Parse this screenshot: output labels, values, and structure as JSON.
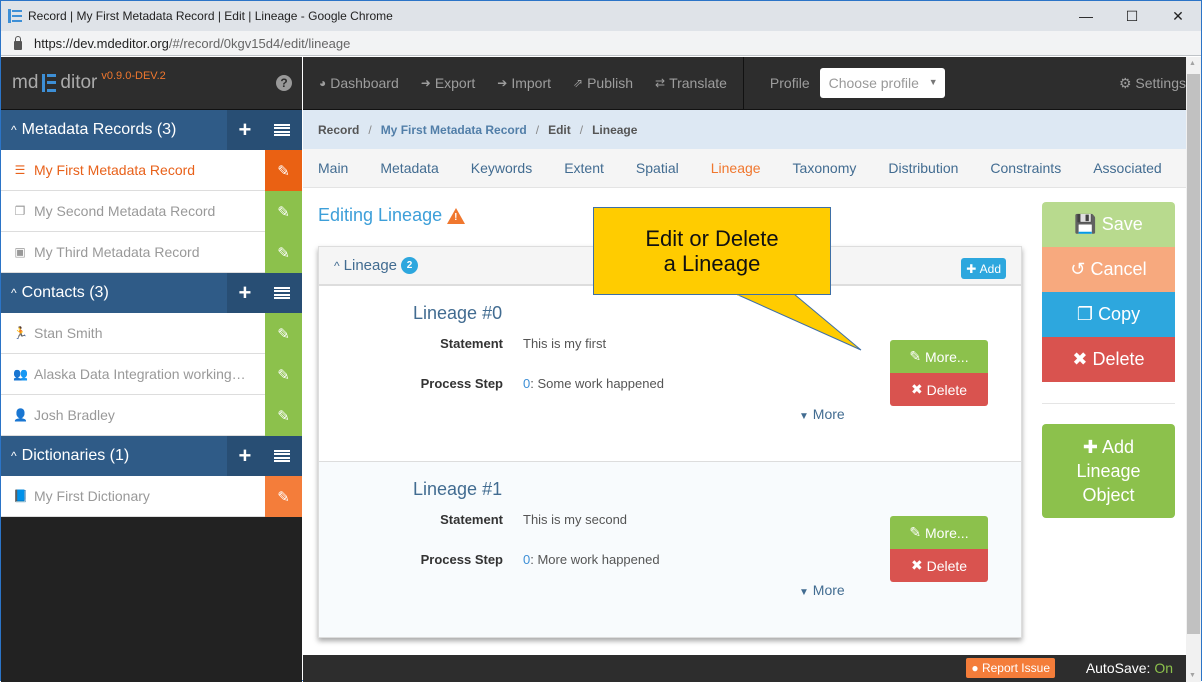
{
  "browser": {
    "title": "Record | My First Metadata Record | Edit | Lineage - Google Chrome",
    "url_host": "https://dev.mdeditor.org",
    "url_path": "/#/record/0kgv15d4/edit/lineage",
    "controls": {
      "minimize": "—",
      "maximize": "☐",
      "close": "✕"
    }
  },
  "brand": {
    "left": "md",
    "right": "ditor",
    "version": "v0.9.0-DEV.2",
    "help": "?"
  },
  "sidebar": {
    "sections": [
      {
        "label": "Metadata Records (3)",
        "items": [
          {
            "label": "My First Metadata Record",
            "icon": "database-icon",
            "glyph": "☰",
            "active": true
          },
          {
            "label": "My Second Metadata Record",
            "icon": "copy-icon",
            "glyph": "❐"
          },
          {
            "label": "My Third Metadata Record",
            "icon": "image-icon",
            "glyph": "▣"
          }
        ]
      },
      {
        "label": "Contacts (3)",
        "items": [
          {
            "label": "Stan Smith",
            "icon": "runner-icon",
            "glyph": "🏃"
          },
          {
            "label": "Alaska Data Integration working…",
            "icon": "group-icon",
            "glyph": "👥"
          },
          {
            "label": "Josh Bradley",
            "icon": "user-icon",
            "glyph": "👤"
          }
        ]
      },
      {
        "label": "Dictionaries (1)",
        "items": [
          {
            "label": "My First Dictionary",
            "icon": "book-icon",
            "glyph": "📘"
          }
        ]
      }
    ]
  },
  "topnav": {
    "items": [
      {
        "label": "Dashboard",
        "glyph": "◕"
      },
      {
        "label": "Export",
        "glyph": "➜"
      },
      {
        "label": "Import",
        "glyph": "➔"
      },
      {
        "label": "Publish",
        "glyph": "⇗"
      },
      {
        "label": "Translate",
        "glyph": "⇄"
      }
    ],
    "profile_label": "Profile",
    "profile_placeholder": "Choose profile",
    "settings": "Settings"
  },
  "breadcrumb": [
    "Record",
    "My First Metadata Record",
    "Edit",
    "Lineage"
  ],
  "tabs": [
    "Main",
    "Metadata",
    "Keywords",
    "Extent",
    "Spatial",
    "Lineage",
    "Taxonomy",
    "Distribution",
    "Constraints",
    "Associated"
  ],
  "active_tab": "Lineage",
  "page_title": "Editing Lineage",
  "panel": {
    "title": "Lineage",
    "count": "2",
    "add_label": "Add",
    "lineages": [
      {
        "title": "Lineage #0",
        "statement_label": "Statement",
        "statement": "This is my first",
        "step_label": "Process Step",
        "step_num": "0",
        "step_text": ": Some work happened",
        "more_link": "More",
        "more_btn": "More...",
        "delete_btn": "Delete"
      },
      {
        "title": "Lineage #1",
        "statement_label": "Statement",
        "statement": "This is my second",
        "step_label": "Process Step",
        "step_num": "0",
        "step_text": ": More work happened",
        "more_link": "More",
        "more_btn": "More...",
        "delete_btn": "Delete"
      }
    ]
  },
  "actions": {
    "save": "Save",
    "cancel": "Cancel",
    "copy": "Copy",
    "delete": "Delete",
    "add_object": [
      "Add",
      "Lineage",
      "Object"
    ]
  },
  "footer": {
    "report": "Report Issue",
    "autosave_label": "AutoSave:",
    "autosave_value": "On"
  },
  "callout": {
    "line1": "Edit or Delete",
    "line2": "a Lineage"
  }
}
